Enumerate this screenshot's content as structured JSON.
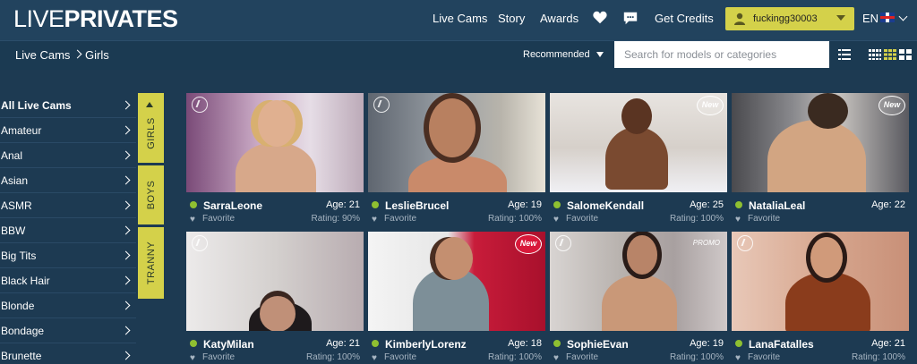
{
  "header": {
    "logo_light": "LIVE",
    "logo_bold": "PRIVATES",
    "nav": [
      "Live Cams",
      "Story",
      "Awards"
    ],
    "get_credits": "Get Credits",
    "username": "fuckingg30003",
    "language": "EN",
    "accent_color": "#d4d14a"
  },
  "subbar": {
    "breadcrumb_root": "Live Cams",
    "breadcrumb_current": "Girls",
    "sort_label": "Recommended",
    "search_placeholder": "Search for models or categories"
  },
  "sidebar": {
    "categories": [
      "All Live Cams",
      "Amateur",
      "Anal",
      "Asian",
      "ASMR",
      "BBW",
      "Big Tits",
      "Black Hair",
      "Blonde",
      "Bondage",
      "Brunette"
    ]
  },
  "gender_tabs": [
    "GIRLS",
    "BOYS",
    "TRANNY"
  ],
  "models": [
    {
      "name": "SarraLeone",
      "age": "Age: 21",
      "favorite": "Favorite",
      "rating": "Rating: 90%",
      "badge": "hd"
    },
    {
      "name": "LeslieBrucel",
      "age": "Age: 19",
      "favorite": "Favorite",
      "rating": "Rating: 100%",
      "badge": "hd"
    },
    {
      "name": "SalomeKendall",
      "age": "Age: 25",
      "favorite": "Favorite",
      "rating": "Rating: 100%",
      "badge": "new"
    },
    {
      "name": "NataliaLeal",
      "age": "Age: 22",
      "favorite": "Favorite",
      "rating": "",
      "badge": "new"
    },
    {
      "name": "KatyMilan",
      "age": "Age: 21",
      "favorite": "Favorite",
      "rating": "Rating: 100%",
      "badge": "hd"
    },
    {
      "name": "KimberlyLorenz",
      "age": "Age: 18",
      "favorite": "Favorite",
      "rating": "Rating: 100%",
      "badge": "new"
    },
    {
      "name": "SophieEvan",
      "age": "Age: 19",
      "favorite": "Favorite",
      "rating": "Rating: 100%",
      "badge": "hd"
    },
    {
      "name": "LanaFatalles",
      "age": "Age: 21",
      "favorite": "Favorite",
      "rating": "Rating: 100%",
      "badge": "hd"
    }
  ],
  "thumb_badge_new": "New",
  "thumb_badge_promo": "PROMO"
}
